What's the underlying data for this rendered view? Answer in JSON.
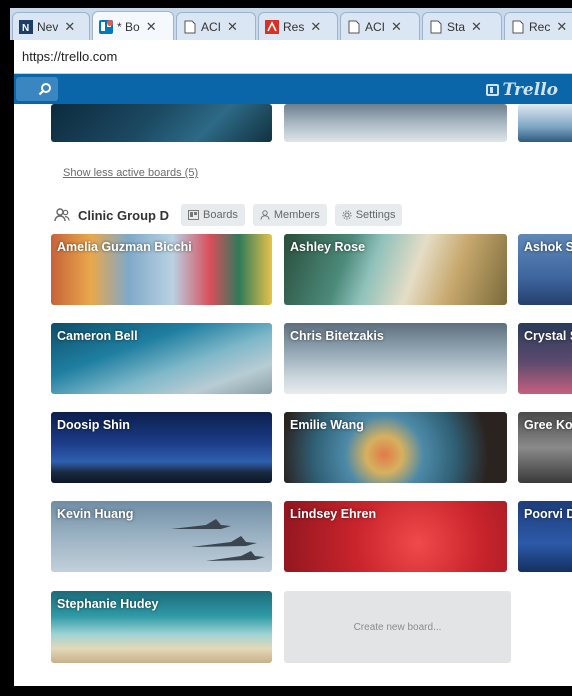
{
  "browser": {
    "tabs": [
      {
        "label": "Nev",
        "icon": "news-icon"
      },
      {
        "label": "* Bo",
        "icon": "trello-icon",
        "active": true
      },
      {
        "label": "ACI",
        "icon": "page-icon"
      },
      {
        "label": "Res",
        "icon": "pdf-icon"
      },
      {
        "label": "ACI",
        "icon": "page-icon"
      },
      {
        "label": "Sta",
        "icon": "page-icon"
      },
      {
        "label": "Rec",
        "icon": "page-icon"
      }
    ],
    "close_glyph": "✕",
    "url": "https://trello.com"
  },
  "header": {
    "search_icon": "search-icon",
    "brand": "Trello",
    "color": "#0a66a8"
  },
  "active_boards": {
    "show_less_label": "Show less active boards (5)"
  },
  "team": {
    "name": "Clinic Group D",
    "buttons": [
      {
        "label": "Boards",
        "icon": "boards-icon"
      },
      {
        "label": "Members",
        "icon": "person-icon"
      },
      {
        "label": "Settings",
        "icon": "gear-icon"
      }
    ],
    "boards": [
      {
        "title": "Amelia Guzman Bicchi"
      },
      {
        "title": "Ashley Rose"
      },
      {
        "title": "Ashok S"
      },
      {
        "title": "Cameron Bell"
      },
      {
        "title": "Chris Bitetzakis"
      },
      {
        "title": "Crystal S"
      },
      {
        "title": "Doosip Shin"
      },
      {
        "title": "Emilie Wang"
      },
      {
        "title": "Gree Kor"
      },
      {
        "title": "Kevin Huang"
      },
      {
        "title": "Lindsey Ehren"
      },
      {
        "title": "Poorvi D"
      },
      {
        "title": "Stephanie Hudey"
      }
    ],
    "create_label": "Create new board..."
  }
}
